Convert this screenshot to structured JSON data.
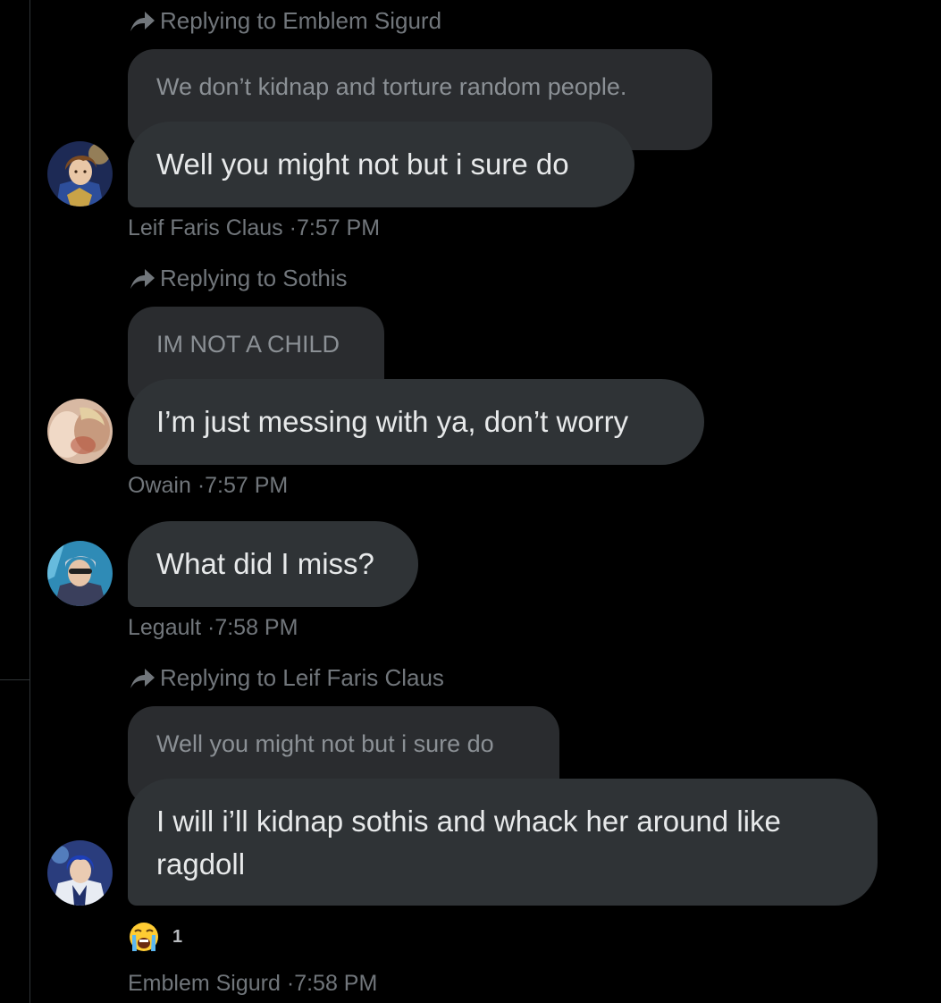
{
  "thread": {
    "messages": [
      {
        "reply_to": "Replying to Emblem Sigurd",
        "quoted": "We don’t kidnap and torture random people.",
        "text": "Well you might not but i sure do",
        "author": "Leif Faris Claus",
        "separator": "·",
        "time": "7:57 PM",
        "avatar_icon": "avatar-leif-icon"
      },
      {
        "reply_to": "Replying to Sothis",
        "quoted": "IM NOT A CHILD",
        "text": "I’m just messing with ya, don’t worry",
        "author": "Owain",
        "separator": "·",
        "time": "7:57 PM",
        "avatar_icon": "avatar-owain-icon"
      },
      {
        "text": "What did I miss?",
        "author": "Legault",
        "separator": "·",
        "time": "7:58 PM",
        "avatar_icon": "avatar-legault-icon"
      },
      {
        "reply_to": "Replying to Leif Faris Claus",
        "quoted": "Well you might not but i sure do",
        "text": "I will i’ll kidnap sothis and whack her around like ragdoll",
        "author": "Emblem Sigurd",
        "separator": "·",
        "time": "7:58 PM",
        "avatar_icon": "avatar-sigurd-icon",
        "reaction": {
          "emoji": "loudly-crying-face-icon",
          "count": "1"
        }
      }
    ]
  },
  "colors": {
    "background": "#000000",
    "bubble": "#2f3336",
    "quoted_bubble": "#2a2c2f",
    "muted_text": "#71767b",
    "primary_text": "#e7e9ea"
  }
}
